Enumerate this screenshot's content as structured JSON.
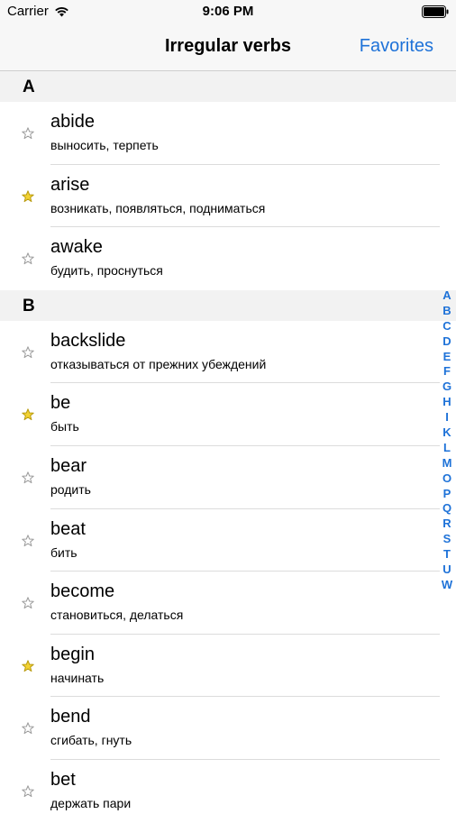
{
  "status": {
    "carrier": "Carrier",
    "time": "9:06 PM"
  },
  "nav": {
    "title": "Irregular verbs",
    "favorites_label": "Favorites"
  },
  "sections": [
    {
      "letter": "A",
      "items": [
        {
          "verb": "abide",
          "translation": "выносить, терпеть",
          "favorite": false
        },
        {
          "verb": "arise",
          "translation": "возникать, появляться, подниматься",
          "favorite": true
        },
        {
          "verb": "awake",
          "translation": "будить, проснуться",
          "favorite": false
        }
      ]
    },
    {
      "letter": "B",
      "items": [
        {
          "verb": "backslide",
          "translation": "отказываться от прежних убеждений",
          "favorite": false
        },
        {
          "verb": "be",
          "translation": "быть",
          "favorite": true
        },
        {
          "verb": "bear",
          "translation": "родить",
          "favorite": false
        },
        {
          "verb": "beat",
          "translation": "бить",
          "favorite": false
        },
        {
          "verb": "become",
          "translation": "становиться, делаться",
          "favorite": false
        },
        {
          "verb": "begin",
          "translation": "начинать",
          "favorite": true
        },
        {
          "verb": "bend",
          "translation": "сгибать, гнуть",
          "favorite": false
        },
        {
          "verb": "bet",
          "translation": "держать пари",
          "favorite": false
        }
      ]
    }
  ],
  "index_letters": [
    "A",
    "B",
    "C",
    "D",
    "E",
    "F",
    "G",
    "H",
    "I",
    "K",
    "L",
    "M",
    "O",
    "P",
    "Q",
    "R",
    "S",
    "T",
    "U",
    "W"
  ],
  "colors": {
    "accent": "#1e72d8",
    "star_filled": "#f2d233",
    "star_empty": "#9a9a9a"
  }
}
